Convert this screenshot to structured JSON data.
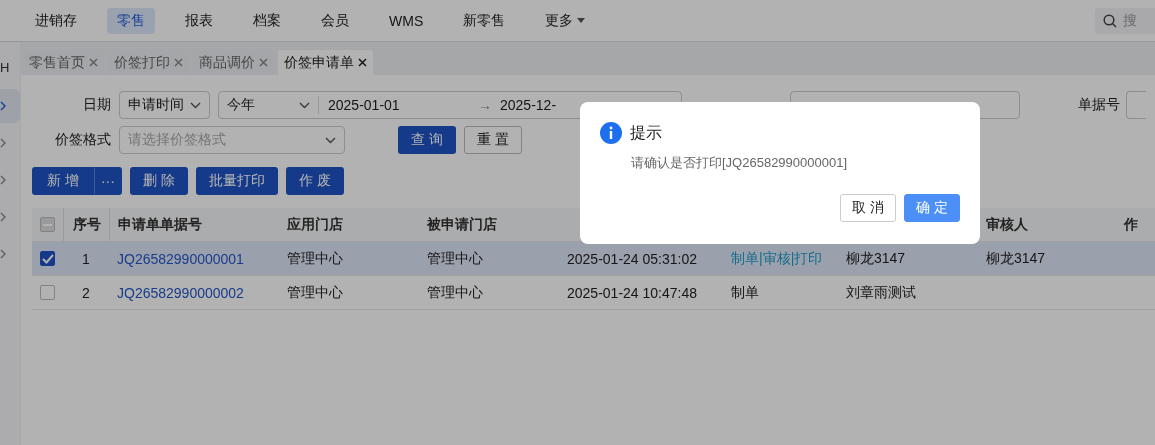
{
  "top_nav": {
    "items": [
      {
        "label": "进销存",
        "selected": false
      },
      {
        "label": "零售",
        "selected": true
      },
      {
        "label": "报表",
        "selected": false
      },
      {
        "label": "档案",
        "selected": false
      },
      {
        "label": "会员",
        "selected": false
      },
      {
        "label": "WMS",
        "selected": false
      },
      {
        "label": "新零售",
        "selected": false
      },
      {
        "label": "更多",
        "selected": false,
        "kind": "dropdown"
      }
    ],
    "search": {
      "placeholder": "搜"
    }
  },
  "sidebar": {
    "label": "H",
    "items": [
      {
        "selected": true
      },
      {
        "selected": false
      },
      {
        "selected": false
      },
      {
        "selected": false
      },
      {
        "selected": false
      }
    ]
  },
  "tabs": [
    {
      "label": "零售首页",
      "selected": false
    },
    {
      "label": "价签打印",
      "selected": false
    },
    {
      "label": "商品调价",
      "selected": false
    },
    {
      "label": "价签申请单",
      "selected": true
    }
  ],
  "filters": {
    "date_label": "日期",
    "date_type": "申请时间",
    "range": "今年",
    "start": "2025-01-01",
    "range_arrow": "→",
    "end": "2025-12-",
    "doc_label": "单据号",
    "format_label": "价签格式",
    "format_placeholder": "请选择价签格式",
    "query": "查 询",
    "reset": "重 置"
  },
  "actions": {
    "add": "新 增",
    "more": "···",
    "delete": "删 除",
    "batch_print": "批量打印",
    "void": "作 废"
  },
  "table": {
    "all_checked": false,
    "columns": [
      "序号",
      "申请单单据号",
      "应用门店",
      "被申请门店"
    ],
    "columns_right": [
      "审核人",
      "作"
    ],
    "rows": [
      {
        "selected": true,
        "no": "1",
        "doc": "JQ26582990000001",
        "store": "管理中心",
        "target": "管理中心",
        "time": "2025-01-24 05:31:02",
        "flow": "制单|审核|打印",
        "flow_linked": true,
        "maker": "柳龙3147",
        "auditor": "柳龙3147"
      },
      {
        "selected": false,
        "no": "2",
        "doc": "JQ26582990000002",
        "store": "管理中心",
        "target": "管理中心",
        "time": "2025-01-24 10:47:48",
        "flow": "制单",
        "flow_linked": false,
        "maker": "刘章雨测试"
      }
    ]
  },
  "dialog": {
    "title": "提示",
    "message": "请确认是否打印[JQ26582990000001]",
    "cancel": "取 消",
    "ok": "确 定"
  }
}
